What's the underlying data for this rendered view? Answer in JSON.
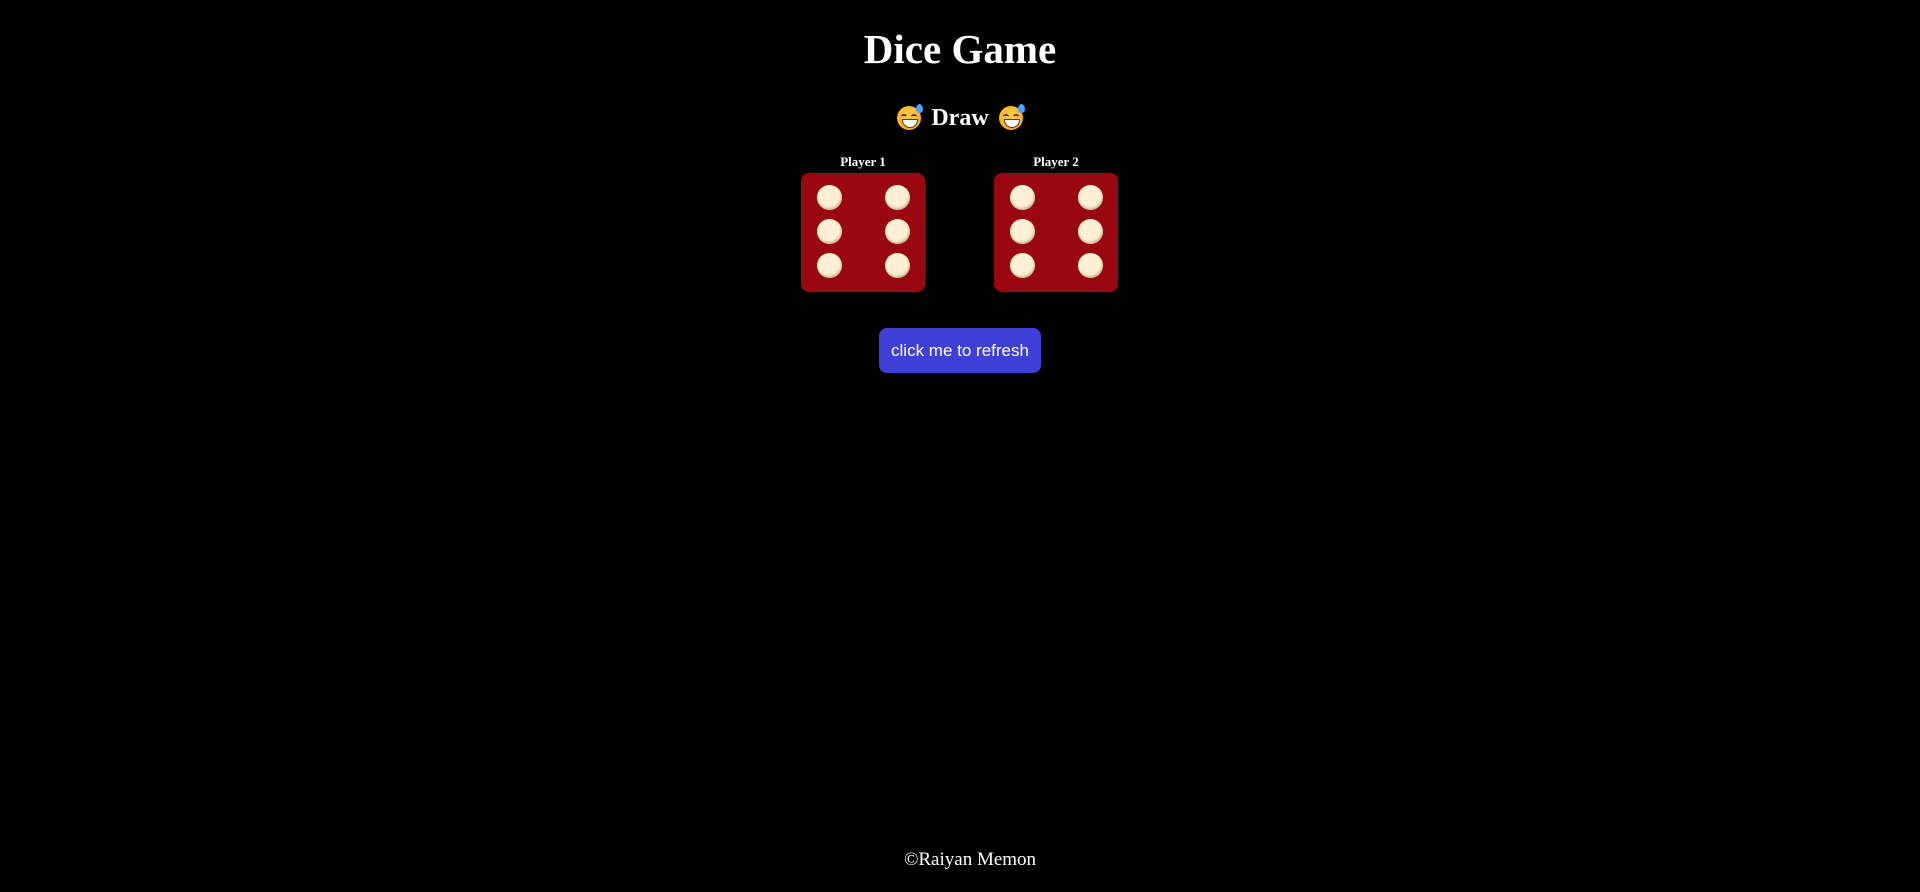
{
  "title": "Dice Game",
  "result": {
    "text": "Draw",
    "emoji_icon": "grinning-face-with-sweat-icon"
  },
  "players": [
    {
      "label": "Player 1",
      "die_value": 6
    },
    {
      "label": "Player 2",
      "die_value": 6
    }
  ],
  "refresh_button_label": "click me to refresh",
  "footer": "©Raiyan Memon",
  "colors": {
    "background": "#000000",
    "die": "#9b0710",
    "pip": "#fdf0d5",
    "button": "#3e3ed9"
  }
}
